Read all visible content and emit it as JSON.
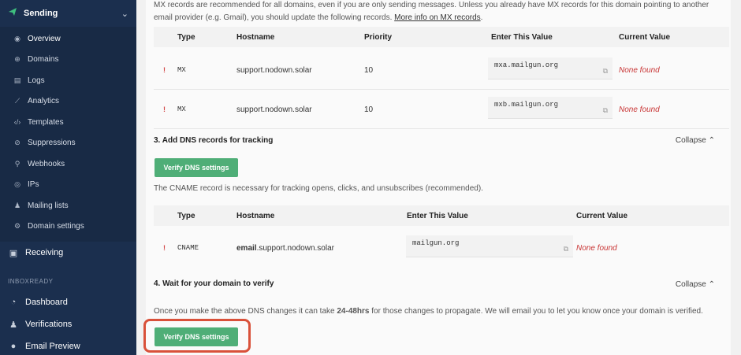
{
  "sidebar": {
    "sending": {
      "label": "Sending",
      "icon": "paper-plane-icon"
    },
    "items": [
      {
        "label": "Overview",
        "icon": "eye-icon"
      },
      {
        "label": "Domains",
        "icon": "globe-icon"
      },
      {
        "label": "Logs",
        "icon": "document-icon"
      },
      {
        "label": "Analytics",
        "icon": "chart-icon"
      },
      {
        "label": "Templates",
        "icon": "code-icon"
      },
      {
        "label": "Suppressions",
        "icon": "block-icon"
      },
      {
        "label": "Webhooks",
        "icon": "webhook-icon"
      },
      {
        "label": "IPs",
        "icon": "location-icon"
      },
      {
        "label": "Mailing lists",
        "icon": "people-icon"
      },
      {
        "label": "Domain settings",
        "icon": "gear-icon"
      }
    ],
    "receiving": {
      "label": "Receiving",
      "icon": "inbox-icon"
    },
    "group_label": "INBOXREADY",
    "inbox_items": [
      {
        "label": "Dashboard",
        "icon": "dashboard-icon"
      },
      {
        "label": "Verifications",
        "icon": "people-icon"
      },
      {
        "label": "Email Preview",
        "icon": "pin-icon"
      }
    ]
  },
  "mx": {
    "intro_line1": "MX records are recommended for all domains, even if you are only sending messages. Unless you already have MX records for this domain pointing to another",
    "intro_line2": "email provider (e.g. Gmail), you should update the following records.",
    "intro_link": "More info on MX records",
    "intro_end": ".",
    "headers": {
      "type": "Type",
      "hostname": "Hostname",
      "priority": "Priority",
      "value": "Enter This Value",
      "current": "Current Value"
    },
    "rows": [
      {
        "type": "MX",
        "hostname": "support.nodown.solar",
        "priority": "10",
        "value": "mxa.mailgun.org",
        "current": "None found"
      },
      {
        "type": "MX",
        "hostname": "support.nodown.solar",
        "priority": "10",
        "value": "mxb.mailgun.org",
        "current": "None found"
      }
    ]
  },
  "tracking": {
    "title": "3. Add DNS records for tracking",
    "collapse": "Collapse",
    "button": "Verify DNS settings",
    "note": "The CNAME record is necessary for tracking opens, clicks, and unsubscribes (recommended).",
    "headers": {
      "type": "Type",
      "hostname": "Hostname",
      "value": "Enter This Value",
      "current": "Current Value"
    },
    "row": {
      "type": "CNAME",
      "hostname_bold": "email",
      "hostname_rest": ".support.nodown.solar",
      "value": "mailgun.org",
      "current": "None found"
    }
  },
  "verify": {
    "title": "4. Wait for your domain to verify",
    "collapse": "Collapse",
    "note_pre": "Once you make the above DNS changes it can take ",
    "note_bold": "24-48hrs",
    "note_post": " for those changes to propagate. We will email you to let you know once your domain is verified.",
    "button": "Verify DNS settings"
  },
  "colors": {
    "sidebar": "#1b2f4e",
    "accent_green": "#4fae77",
    "highlight": "#d9513a",
    "not_found": "#c83434"
  }
}
